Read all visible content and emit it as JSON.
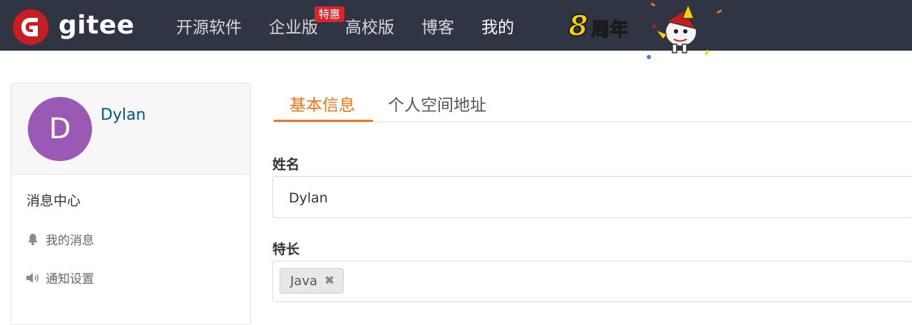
{
  "brand": {
    "name": "gitee",
    "logo_letter": "G"
  },
  "nav": {
    "items": [
      {
        "label": "开源软件",
        "active": false
      },
      {
        "label": "企业版",
        "active": false
      },
      {
        "label": "高校版",
        "active": false
      },
      {
        "label": "博客",
        "active": false
      },
      {
        "label": "我的",
        "active": true
      }
    ],
    "badge": "特惠",
    "anniversary": {
      "number": "8",
      "text": "周年"
    }
  },
  "sidebar": {
    "avatar_initial": "D",
    "username": "Dylan",
    "section_title": "消息中心",
    "links": [
      {
        "label": "我的消息",
        "icon": "bell-icon"
      },
      {
        "label": "通知设置",
        "icon": "volume-icon"
      }
    ]
  },
  "tabs": [
    {
      "label": "基本信息",
      "active": true
    },
    {
      "label": "个人空间地址",
      "active": false
    }
  ],
  "form": {
    "name_label": "姓名",
    "name_value": "Dylan",
    "skills_label": "特长",
    "skills": [
      {
        "label": "Java",
        "remove_icon": "✖"
      }
    ]
  },
  "colors": {
    "accent": "#e8761c",
    "nav_bg": "#2f3542",
    "brand_red": "#c71d23",
    "avatar": "#9b59b6",
    "link": "#005980"
  }
}
